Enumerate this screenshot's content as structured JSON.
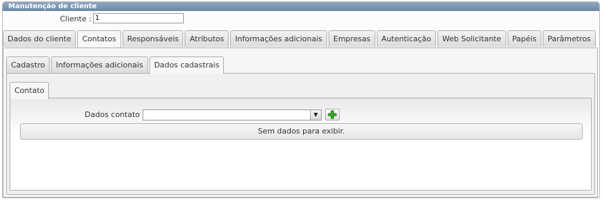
{
  "panel": {
    "title": "Manutenção de cliente"
  },
  "cliente": {
    "label": "Cliente :",
    "value": "1"
  },
  "main_tabs": [
    {
      "label": "Dados do cliente"
    },
    {
      "label": "Contatos"
    },
    {
      "label": "Responsáveis"
    },
    {
      "label": "Atributos"
    },
    {
      "label": "Informações adicionais"
    },
    {
      "label": "Empresas"
    },
    {
      "label": "Autenticação"
    },
    {
      "label": "Web Solicitante"
    },
    {
      "label": "Papéis"
    },
    {
      "label": "Parâmetros"
    }
  ],
  "main_active": "Contatos",
  "sub_tabs": [
    {
      "label": "Cadastro"
    },
    {
      "label": "Informações adicionais"
    },
    {
      "label": "Dados cadastrais"
    }
  ],
  "sub_active": "Dados cadastrais",
  "inner_tabs": [
    {
      "label": "Contato"
    }
  ],
  "contact": {
    "label": "Dados contato :",
    "selected": "",
    "empty_text": "Sem dados para exibir."
  },
  "icons": {
    "add": "add-plus-icon",
    "dropdown": "chevron-down-icon"
  },
  "colors": {
    "header": "#7893ae",
    "add_icon": "#3aa52a"
  }
}
